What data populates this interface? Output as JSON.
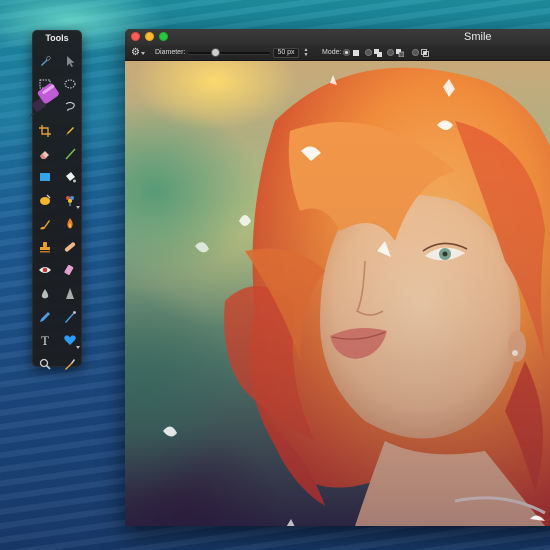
{
  "tools_panel": {
    "title": "Tools",
    "tools": [
      {
        "name": "pipette-icon"
      },
      {
        "name": "move-arrow-icon"
      },
      {
        "name": "rect-select-icon"
      },
      {
        "name": "ellipse-select-icon"
      },
      {
        "name": "magic-wand-icon"
      },
      {
        "name": "lasso-icon"
      },
      {
        "name": "crop-icon"
      },
      {
        "name": "pen-icon"
      },
      {
        "name": "eraser-icon"
      },
      {
        "name": "line-icon"
      },
      {
        "name": "rectangle-shape-icon"
      },
      {
        "name": "paint-bucket-icon"
      },
      {
        "name": "smudge-icon"
      },
      {
        "name": "color-picker-icon"
      },
      {
        "name": "brush-icon"
      },
      {
        "name": "burn-icon"
      },
      {
        "name": "clone-stamp-icon"
      },
      {
        "name": "bandage-icon"
      },
      {
        "name": "red-eye-icon"
      },
      {
        "name": "eraser-pink-icon"
      },
      {
        "name": "drop-icon"
      },
      {
        "name": "sharpen-icon"
      },
      {
        "name": "pencil-icon"
      },
      {
        "name": "airbrush-icon"
      },
      {
        "name": "text-icon"
      },
      {
        "name": "heart-shape-icon"
      },
      {
        "name": "zoom-icon"
      },
      {
        "name": "eyedropper-icon"
      }
    ]
  },
  "window": {
    "title": "Smile",
    "options_bar": {
      "diameter_label": "Diameter:",
      "diameter_value": "50 px",
      "diameter_level": 0.34,
      "mode_label": "Mode:"
    }
  },
  "colors": {
    "accent_pink": "#c05bd6",
    "hair_orange": "#f08a3a",
    "hair_red": "#d2402a",
    "skin": "#f1c9a4"
  }
}
